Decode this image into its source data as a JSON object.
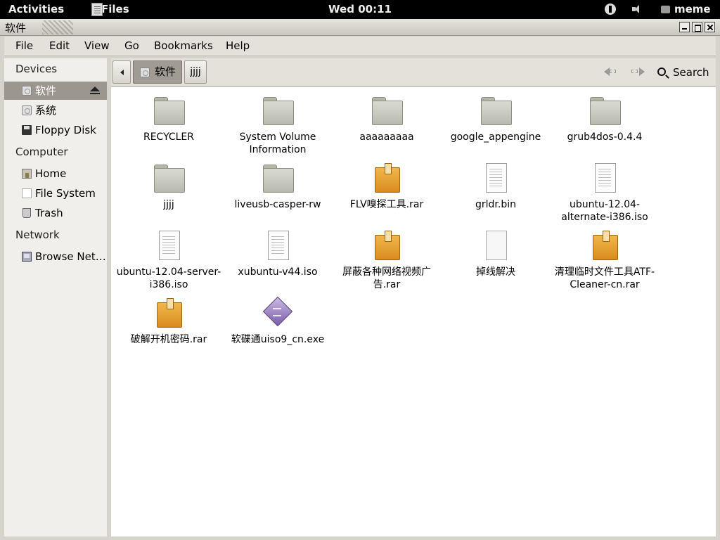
{
  "topbar": {
    "activities": "Activities",
    "app_name": "Files",
    "clock": "Wed 00:11",
    "user": "meme"
  },
  "window": {
    "title": "软件"
  },
  "menubar": [
    "File",
    "Edit",
    "View",
    "Go",
    "Bookmarks",
    "Help"
  ],
  "sidebar": {
    "devices_heading": "Devices",
    "devices": [
      "软件",
      "系统",
      "Floppy Disk"
    ],
    "computer_heading": "Computer",
    "computer": [
      "Home",
      "File System",
      "Trash"
    ],
    "network_heading": "Network",
    "network": [
      "Browse Net…"
    ]
  },
  "toolbar": {
    "path_drive": "软件",
    "path_folder": "jjjj",
    "search_label": "Search"
  },
  "items": [
    {
      "name": "RECYCLER",
      "type": "folder"
    },
    {
      "name": "System Volume Information",
      "type": "folder"
    },
    {
      "name": "aaaaaaaaa",
      "type": "folder"
    },
    {
      "name": "google_appengine",
      "type": "folder"
    },
    {
      "name": "grub4dos-0.4.4",
      "type": "folder"
    },
    {
      "name": "jjjj",
      "type": "folder"
    },
    {
      "name": "liveusb-casper-rw",
      "type": "folder"
    },
    {
      "name": "FLV嗅探工具.rar",
      "type": "archive"
    },
    {
      "name": "grldr.bin",
      "type": "file"
    },
    {
      "name": "ubuntu-12.04-alternate-i386.iso",
      "type": "file"
    },
    {
      "name": "ubuntu-12.04-server-i386.iso",
      "type": "file"
    },
    {
      "name": "xubuntu-v44.iso",
      "type": "file"
    },
    {
      "name": "屏蔽各种网络视频广告.rar",
      "type": "archive"
    },
    {
      "name": "掉线解决",
      "type": "blank"
    },
    {
      "name": "清理临时文件工具ATF-Cleaner-cn.rar",
      "type": "archive"
    },
    {
      "name": "破解开机密码.rar",
      "type": "archive"
    },
    {
      "name": "软碟通uiso9_cn.exe",
      "type": "exe"
    }
  ]
}
